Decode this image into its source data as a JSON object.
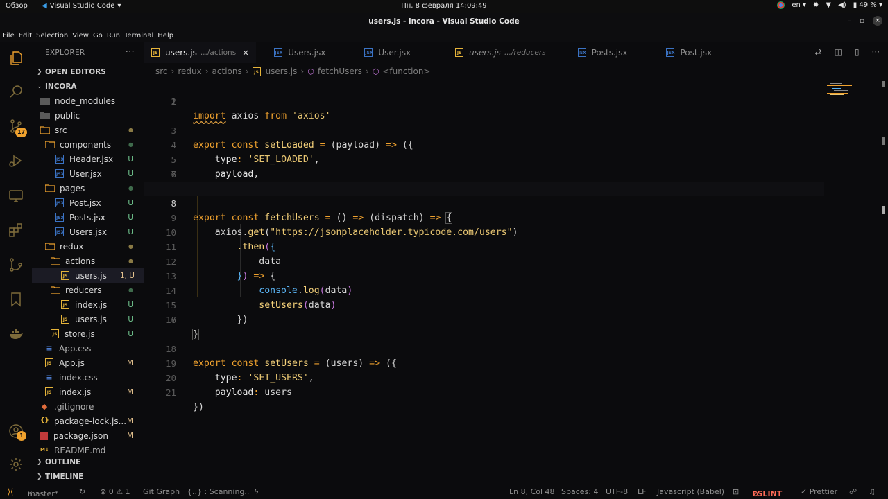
{
  "topbar": {
    "activities": "Обзор",
    "app_name": "Visual Studio Code",
    "datetime": "Пн, 8 февраля  14:09:49",
    "lang": "en",
    "battery": "49 %"
  },
  "window": {
    "title": "users.js - incora - Visual Studio Code",
    "min": "–",
    "max": "▫",
    "close": "×"
  },
  "menu": [
    "File",
    "Edit",
    "Selection",
    "View",
    "Go",
    "Run",
    "Terminal",
    "Help"
  ],
  "activity": {
    "scm_badge": "17",
    "accounts_badge": "1"
  },
  "explorer": {
    "title": "EXPLORER",
    "more": "···",
    "open_editors": "OPEN EDITORS",
    "root": "INCORA",
    "outline": "OUTLINE",
    "timeline": "TIMELINE",
    "items": [
      {
        "name": "node_modules",
        "deco": ""
      },
      {
        "name": "public",
        "deco": ""
      },
      {
        "name": "src",
        "deco": "●"
      },
      {
        "name": "components",
        "deco": "●"
      },
      {
        "name": "Header.jsx",
        "deco": "U"
      },
      {
        "name": "User.jsx",
        "deco": "U"
      },
      {
        "name": "pages",
        "deco": "●"
      },
      {
        "name": "Post.jsx",
        "deco": "U"
      },
      {
        "name": "Posts.jsx",
        "deco": "U"
      },
      {
        "name": "Users.jsx",
        "deco": "U"
      },
      {
        "name": "redux",
        "deco": "●"
      },
      {
        "name": "actions",
        "deco": "●"
      },
      {
        "name": "users.js",
        "deco": "1, U"
      },
      {
        "name": "reducers",
        "deco": "●"
      },
      {
        "name": "index.js",
        "deco": "U"
      },
      {
        "name": "users.js",
        "deco": "U"
      },
      {
        "name": "store.js",
        "deco": "U"
      },
      {
        "name": "App.css",
        "deco": ""
      },
      {
        "name": "App.js",
        "deco": "M"
      },
      {
        "name": "index.css",
        "deco": ""
      },
      {
        "name": "index.js",
        "deco": "M"
      },
      {
        "name": ".gitignore",
        "deco": ""
      },
      {
        "name": "package-lock.js...",
        "deco": "M"
      },
      {
        "name": "package.json",
        "deco": "M"
      },
      {
        "name": "README.md",
        "deco": ""
      }
    ]
  },
  "tabs": [
    {
      "label": "users.js",
      "desc": ".../actions",
      "close": "×"
    },
    {
      "label": "Users.jsx",
      "desc": ""
    },
    {
      "label": "User.jsx",
      "desc": ""
    },
    {
      "label": "users.js",
      "desc": ".../reducers"
    },
    {
      "label": "Posts.jsx",
      "desc": ""
    },
    {
      "label": "Post.jsx",
      "desc": ""
    }
  ],
  "breadcrumb": [
    "src",
    "redux",
    "actions",
    "users.js",
    "fetchUsers",
    "<function>"
  ],
  "code": {
    "lines": [
      "import axios from 'axios'",
      "",
      "export const setLoaded = (payload) => ({",
      "    type: 'SET_LOADED',",
      "    payload,",
      "});",
      "",
      "export const fetchUsers = () => (dispatch) => {",
      "    axios.get(\"https://jsonplaceholder.typicode.com/users\")",
      "        .then(({",
      "            data",
      "        }) => {",
      "            console.log(data)",
      "            setUsers(data)",
      "        })",
      "}",
      "",
      "export const setUsers = (users) => ({",
      "    type: 'SET_USERS',",
      "    payload: users",
      "})"
    ]
  },
  "status": {
    "branch": "master*",
    "problems": "⊗ 0 ⚠ 1",
    "git_graph": "Git Graph",
    "scanning": "{..} : Scanning..",
    "position": "Ln 8, Col 48",
    "spaces": "Spaces: 4",
    "encoding": "UTF-8",
    "eol": "LF",
    "language": "Javascript (Babel)",
    "eslint": "ESLINT",
    "prettier": "✓ Prettier"
  },
  "colors": {
    "accent": "#f0a22e",
    "background": "#0b0b0d",
    "string": "#e8c672",
    "property": "#5ab3f2"
  }
}
